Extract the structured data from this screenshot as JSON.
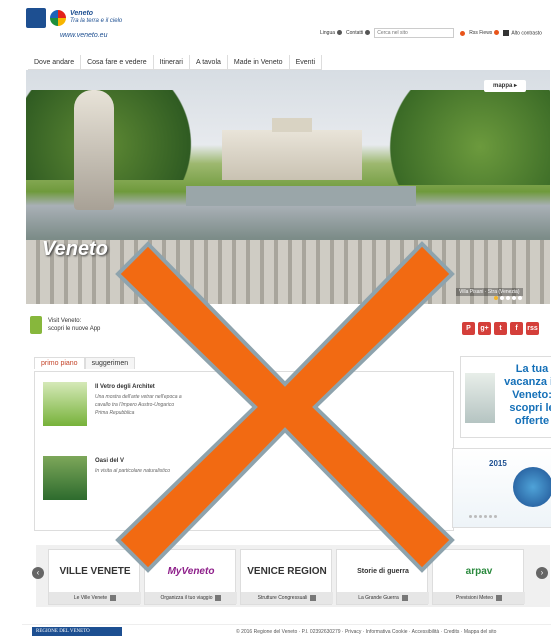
{
  "header": {
    "brand": "Veneto",
    "tagline": "Tra la terra e il cielo",
    "url": "www.veneto.eu"
  },
  "toplinks": {
    "lingua": "Lingua",
    "contatti": "Contatti",
    "search_placeholder": "Cerca nel sito",
    "rss": "Rss Fiews",
    "contrast": "Alto contrasto"
  },
  "nav": {
    "items": [
      "Dove andare",
      "Cosa fare e vedere",
      "Itinerari",
      "A tavola",
      "Made in Veneto",
      "Eventi"
    ]
  },
  "hero": {
    "title": "Veneto",
    "mappa": "mappa",
    "caption": "Villa Pisani · Stra (Venezia)"
  },
  "app_promo": {
    "line1": "Visit Veneto:",
    "line2": "scopri le nuove App"
  },
  "social": [
    "P",
    "g+",
    "t",
    "f",
    "rss"
  ],
  "tabs": [
    "primo piano",
    "suggerimen"
  ],
  "news": [
    {
      "title": "Il Vetro degli Architet",
      "text": "Una mostra dell'arte vetrar nell'epoca a cavallo tra l'Impero Austro-Ungarico Prima Repubblica"
    },
    {
      "title": "Oasi del V",
      "text": "In visita al particolare naturalistico"
    }
  ],
  "promo": {
    "text": "La tua vacanza in Veneto: scopri le offerte"
  },
  "promo2": {
    "year": "2015"
  },
  "carousel": {
    "cards": [
      {
        "logo": "VILLE VENETE",
        "label": "Le Ville Venete"
      },
      {
        "logo": "MyVeneto",
        "label": "Organizza il tuo viaggio"
      },
      {
        "logo": "VENICE REGION",
        "label": "Strutture Congressuali"
      },
      {
        "logo": "Storie di guerra",
        "label": "La Grande Guerra"
      },
      {
        "logo": "arpav",
        "label": "Previsioni Meteo"
      }
    ]
  },
  "footer": {
    "brand": "REGIONE DEL VENETO",
    "text": "© 2016 Regione del Veneto  ·  P.I. 02392630279  ·  Privacy  ·  Informativa Cookie  ·  Accessibilità  ·  Credits  ·  Mappa del sito"
  }
}
